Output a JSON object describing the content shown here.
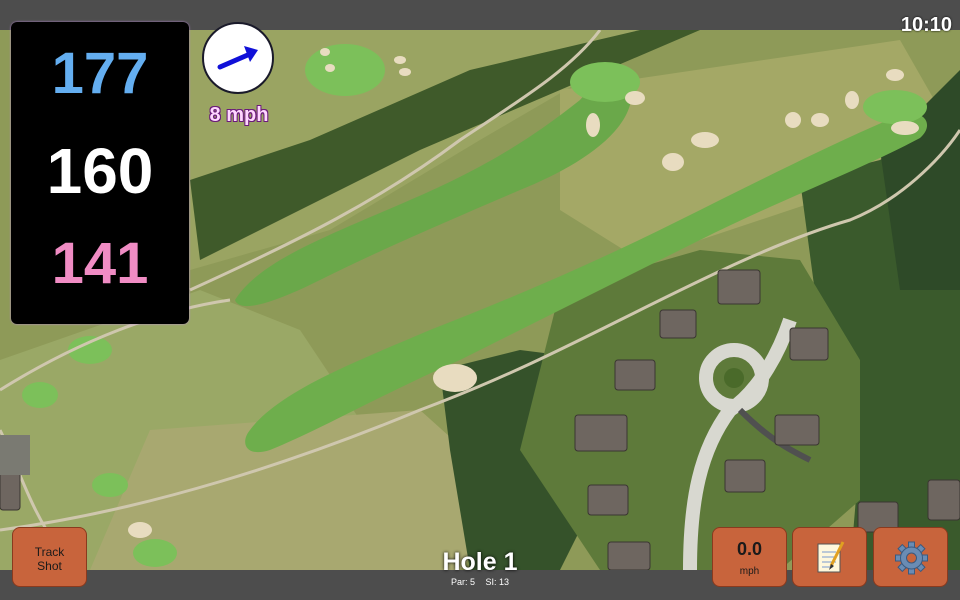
{
  "clock": "10:10",
  "distances": {
    "back": "177",
    "middle": "160",
    "front": "141"
  },
  "wind": {
    "speed": "8 mph",
    "direction_icon": "wind-arrow-icon"
  },
  "buttons": {
    "track_shot_line1": "Track",
    "track_shot_line2": "Shot",
    "speed_value": "0.0",
    "speed_unit": "mph",
    "notes_icon": "notepad-icon",
    "settings_icon": "gear-icon"
  },
  "hole": {
    "title": "Hole 1",
    "par": "Par: 5",
    "si": "SI: 13"
  },
  "colors": {
    "back_distance": "#64aef0",
    "middle_distance": "#ffffff",
    "front_distance": "#f08cc4",
    "button": "#c8643c"
  }
}
